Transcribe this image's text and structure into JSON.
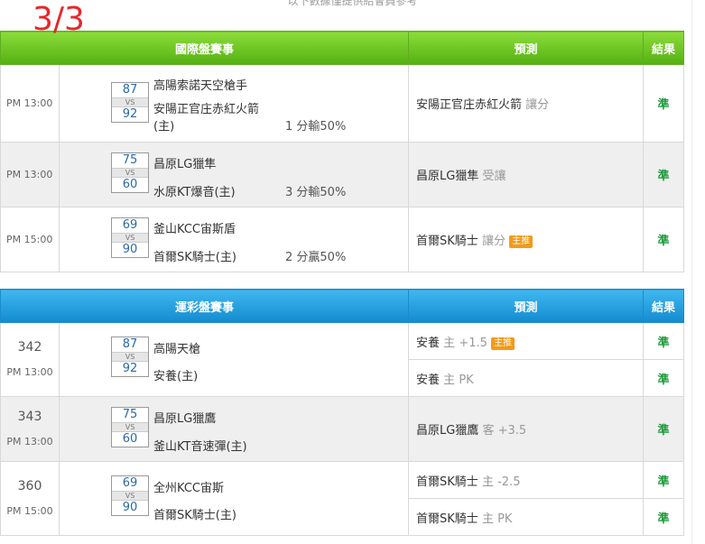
{
  "page_label": "3/3",
  "top_cut_text": "以下數據僅提供給會員參考",
  "intl": {
    "header_event": "國際盤賽事",
    "header_prediction": "預測",
    "header_result": "結果",
    "rows": [
      {
        "time": "PM 13:00",
        "score1": "87",
        "vs": "VS",
        "score2": "92",
        "team1": "高陽索諾天空槍手",
        "team2": "安陽正官庄赤紅火箭",
        "team2b": "(主)",
        "handicap": "1 分輸50%",
        "pred_team": "安陽正官庄赤紅火箭",
        "pred_type": "讓分",
        "tag": "",
        "result": "準"
      },
      {
        "time": "PM 13:00",
        "score1": "75",
        "vs": "VS",
        "score2": "60",
        "team1": "昌原LG獵隼",
        "team2": "水原KT爆音(主)",
        "handicap": "3 分輸50%",
        "pred_team": "昌原LG獵隼",
        "pred_type": "受讓",
        "tag": "",
        "result": "準"
      },
      {
        "time": "PM 15:00",
        "score1": "69",
        "vs": "VS",
        "score2": "90",
        "team1": "釜山KCC宙斯盾",
        "team2": "首爾SK騎士(主)",
        "handicap": "2 分贏50%",
        "pred_team": "首爾SK騎士",
        "pred_type": "讓分",
        "tag": "主推",
        "result": "準"
      }
    ]
  },
  "sport": {
    "header_event": "運彩盤賽事",
    "header_prediction": "預測",
    "header_result": "結果",
    "games": [
      {
        "num": "342",
        "time": "PM 13:00",
        "score1": "87",
        "vs": "VS",
        "score2": "92",
        "team1": "高陽天槍",
        "team2": "安養(主)",
        "preds": [
          {
            "team": "安養",
            "side": "主",
            "line": "+1.5",
            "tag": "主推",
            "result": "準"
          },
          {
            "team": "安養",
            "side": "主",
            "line": "PK",
            "tag": "",
            "result": "準"
          }
        ]
      },
      {
        "num": "343",
        "time": "PM 13:00",
        "score1": "75",
        "vs": "VS",
        "score2": "60",
        "team1": "昌原LG獵鷹",
        "team2": "釜山KT音速彈(主)",
        "preds": [
          {
            "team": "昌原LG獵鷹",
            "side": "客",
            "line": "+3.5",
            "tag": "",
            "result": "準"
          }
        ]
      },
      {
        "num": "360",
        "time": "PM 15:00",
        "score1": "69",
        "vs": "VS",
        "score2": "90",
        "team1": "全州KCC宙斯",
        "team2": "首爾SK騎士(主)",
        "preds": [
          {
            "team": "首爾SK騎士",
            "side": "主",
            "line": "-2.5",
            "tag": "",
            "result": "準"
          },
          {
            "team": "首爾SK騎士",
            "side": "主",
            "line": "PK",
            "tag": "",
            "result": "準"
          }
        ]
      }
    ]
  }
}
